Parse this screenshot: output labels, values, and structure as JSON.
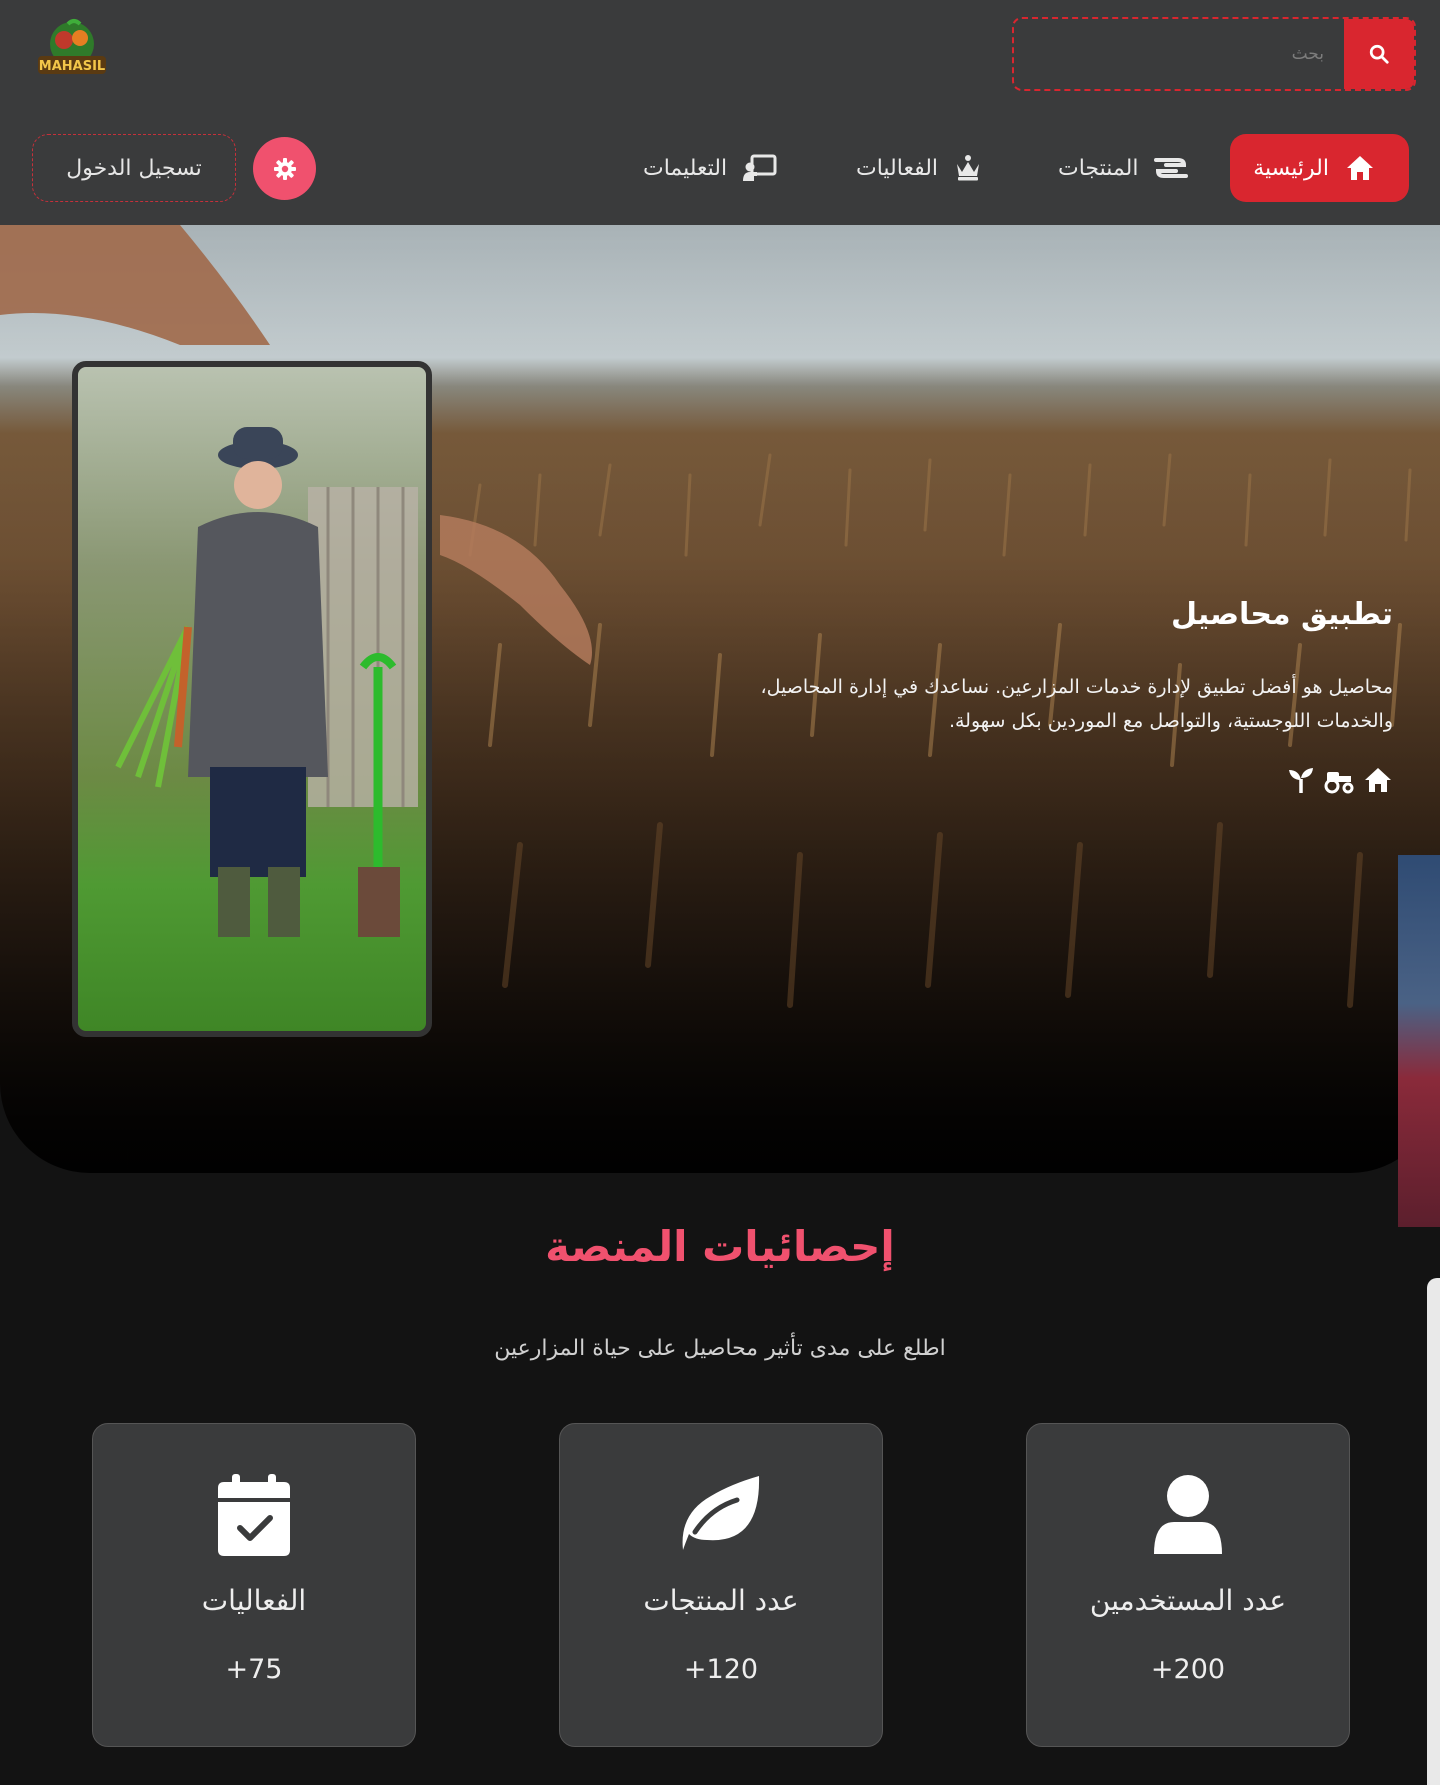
{
  "header": {
    "logo_text": "MAHASIL",
    "search": {
      "placeholder": "بحث"
    },
    "nav": [
      {
        "label": "الرئيسية",
        "icon": "home-icon",
        "active": true
      },
      {
        "label": "المنتجات",
        "icon": "hand-holding-icon",
        "active": false
      },
      {
        "label": "الفعاليات",
        "icon": "chess-queen-icon",
        "active": false
      },
      {
        "label": "التعليمات",
        "icon": "chalkboard-teacher-icon",
        "active": false
      }
    ],
    "settings_icon": "gear-icon",
    "login_label": "تسجيل الدخول"
  },
  "hero": {
    "title": "تطبيق محاصيل",
    "description_line1": "محاصيل هو أفضل تطبيق لإدارة خدمات المزارعين. نساعدك في إدارة المحاصيل،",
    "description_line2": "والخدمات اللوجستية، والتواصل مع الموردين بكل سهولة.",
    "icons": [
      "home-icon",
      "tractor-icon",
      "seedling-icon"
    ]
  },
  "stats": {
    "title": "إحصائيات المنصة",
    "subtitle": "اطلع على مدى تأثير محاصيل على حياة المزارعين",
    "cards": [
      {
        "label": "عدد المستخدمين",
        "value": "200+",
        "icon": "user-icon"
      },
      {
        "label": "عدد المنتجات",
        "value": "120+",
        "icon": "leaf-icon"
      },
      {
        "label": "الفعاليات",
        "value": "75+",
        "icon": "calendar-check-icon"
      }
    ]
  },
  "colors": {
    "accent_red": "#d9262f",
    "accent_pink": "#f0516e",
    "header_bg": "#3a3b3c",
    "page_bg": "#131313",
    "card_bg": "#3a3b3c"
  }
}
